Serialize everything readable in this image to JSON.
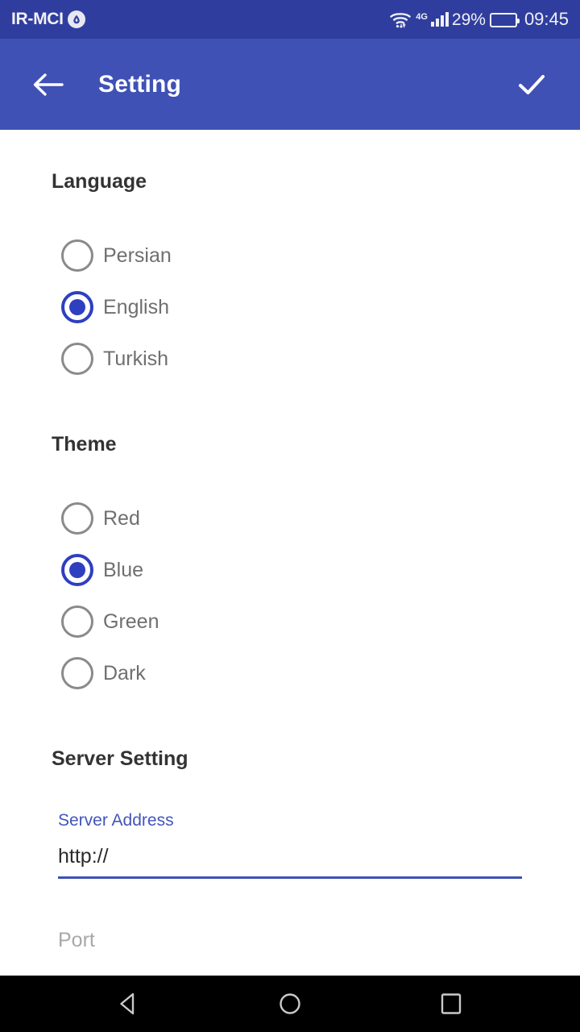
{
  "status_bar": {
    "carrier": "IR-MCI",
    "carrier_badge_icon": "droplet-icon",
    "wifi_icon": "wifi-icon",
    "network_type": "4G",
    "signal_icon": "signal-bars-icon",
    "battery_percent": "29%",
    "battery_level": 29,
    "battery_icon": "battery-icon",
    "clock": "09:45"
  },
  "app_bar": {
    "back_icon": "back-arrow-icon",
    "title": "Setting",
    "confirm_icon": "check-icon"
  },
  "language_section": {
    "heading": "Language",
    "options": [
      {
        "label": "Persian",
        "selected": false
      },
      {
        "label": "English",
        "selected": true
      },
      {
        "label": "Turkish",
        "selected": false
      }
    ]
  },
  "theme_section": {
    "heading": "Theme",
    "options": [
      {
        "label": "Red",
        "selected": false
      },
      {
        "label": "Blue",
        "selected": true
      },
      {
        "label": "Green",
        "selected": false
      },
      {
        "label": "Dark",
        "selected": false
      }
    ]
  },
  "server_section": {
    "heading": "Server Setting",
    "address_field": {
      "label": "Server Address",
      "value": "http://"
    },
    "port_field": {
      "placeholder": "Port",
      "value": ""
    }
  },
  "nav_bar": {
    "back_icon": "nav-back-triangle-icon",
    "home_icon": "nav-home-circle-icon",
    "recents_icon": "nav-recents-square-icon"
  },
  "colors": {
    "status_bar_bg": "#2F3E9E",
    "app_bar_bg": "#3F51B5",
    "accent": "#2E3FC0",
    "label_blue": "#4355bb",
    "heading_text": "#333333",
    "option_text": "#6f6f6f",
    "placeholder_text": "#a8a8a8",
    "nav_bar_bg": "#000000"
  }
}
